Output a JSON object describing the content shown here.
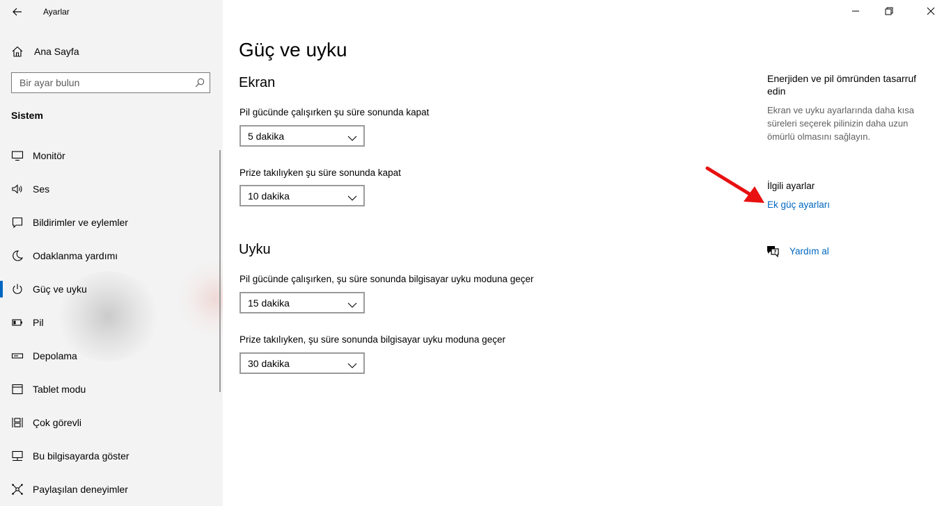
{
  "app": {
    "title": "Ayarlar"
  },
  "sidebar": {
    "home_label": "Ana Sayfa",
    "search_placeholder": "Bir ayar bulun",
    "section_label": "Sistem",
    "items": [
      {
        "label": "Monitör",
        "icon": "monitor-icon"
      },
      {
        "label": "Ses",
        "icon": "speaker-icon"
      },
      {
        "label": "Bildirimler ve eylemler",
        "icon": "notification-icon"
      },
      {
        "label": "Odaklanma yardımı",
        "icon": "moon-icon"
      },
      {
        "label": "Güç ve uyku",
        "icon": "power-icon",
        "active": true
      },
      {
        "label": "Pil",
        "icon": "battery-icon"
      },
      {
        "label": "Depolama",
        "icon": "storage-icon"
      },
      {
        "label": "Tablet modu",
        "icon": "tablet-icon"
      },
      {
        "label": "Çok görevli",
        "icon": "multitask-icon"
      },
      {
        "label": "Bu bilgisayarda göster",
        "icon": "project-icon"
      },
      {
        "label": "Paylaşılan deneyimler",
        "icon": "shared-icon"
      }
    ]
  },
  "main": {
    "title": "Güç ve uyku",
    "screen": {
      "heading": "Ekran",
      "battery_label": "Pil gücünde çalışırken şu süre sonunda kapat",
      "battery_value": "5 dakika",
      "plugged_label": "Prize takılıyken şu süre sonunda kapat",
      "plugged_value": "10 dakika"
    },
    "sleep": {
      "heading": "Uyku",
      "battery_label": "Pil gücünde çalışırken, şu süre sonunda bilgisayar uyku moduna geçer",
      "battery_value": "15 dakika",
      "plugged_label": "Prize takılıyken, şu süre sonunda bilgisayar uyku moduna geçer",
      "plugged_value": "30 dakika"
    }
  },
  "right": {
    "tip_title": "Enerjiden ve pil ömründen tasarruf edin",
    "tip_text": "Ekran ve uyku ayarlarında daha kısa süreleri seçerek pilinizin daha uzun ömürlü olmasını sağlayın.",
    "related_title": "İlgili ayarlar",
    "related_link": "Ek güç ayarları",
    "help_link": "Yardım al"
  },
  "colors": {
    "accent": "#0067c0",
    "annotation_arrow": "#e81010"
  }
}
